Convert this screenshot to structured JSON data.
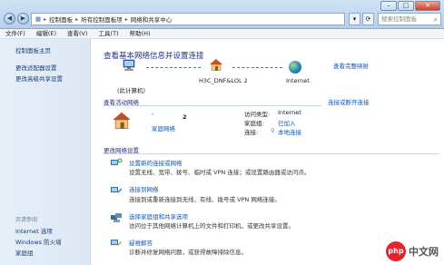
{
  "breadcrumb": [
    "控制面板",
    "所有控制面板项",
    "网络和共享中心"
  ],
  "search": {
    "placeholder": "搜索控制面板"
  },
  "menu": [
    "文件(F)",
    "编辑(E)",
    "查看(V)",
    "工具(T)",
    "帮助(H)"
  ],
  "sidebar": {
    "top_links": [
      "控制面板主页",
      "更改适配器设置",
      "更改高级共享设置"
    ],
    "see_also_heading": "另请参阅",
    "see_also": [
      "Internet 选项",
      "Windows 防火墙",
      "家庭组"
    ]
  },
  "main": {
    "title": "查看基本网络信息并设置连接",
    "view_full_map": "查看完整映射",
    "map": {
      "computer_label": "(此计算机)",
      "network_label": "H3C_DNF&LOL  2",
      "internet_label": "Internet"
    },
    "active_networks_heading": "查看活动网络",
    "connect_disconnect": "连接或断开连接",
    "network": {
      "name_dash": "-",
      "number": "2",
      "type": "家庭网络",
      "access_type_label": "访问类型:",
      "access_type_value": "Internet",
      "homegroup_label": "家庭组:",
      "homegroup_value": "已加入",
      "connections_label": "连接:",
      "connections_value": "本地连接"
    },
    "change_settings_heading": "更改网络设置",
    "tasks": [
      {
        "title": "设置新的连接或网络",
        "desc": "设置无线、宽带、拨号、临时或 VPN 连接；或设置路由器或访问点。"
      },
      {
        "title": "连接到网络",
        "desc": "连接到或重新连接到无线、有线、拨号或 VPN 网络连接。"
      },
      {
        "title": "选择家庭组和共享选项",
        "desc": "访问位于其他网络计算机上的文件和打印机，或更改共享设置。"
      },
      {
        "title": "疑难解答",
        "desc": "诊断并修复网络问题，或获得故障排除信息。"
      }
    ]
  },
  "watermark": {
    "logo": "php",
    "text": "中文网"
  }
}
